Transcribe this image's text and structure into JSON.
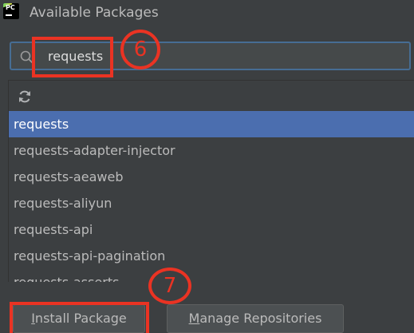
{
  "window": {
    "title": "Available Packages",
    "logo_text": "PC"
  },
  "search": {
    "value": "requests",
    "icon": "search-icon"
  },
  "toolbar": {
    "refresh_icon": "refresh-icon"
  },
  "packages": [
    "requests",
    "requests-adapter-injector",
    "requests-aeaweb",
    "requests-aliyun",
    "requests-api",
    "requests-api-pagination",
    "requests-asserts"
  ],
  "selected_index": 0,
  "buttons": {
    "install_mnemonic": "I",
    "install_rest": "nstall Package",
    "manage_mnemonic": "M",
    "manage_rest": "anage Repositories"
  },
  "annotations": {
    "step6": "6",
    "step7": "7"
  },
  "colors": {
    "background": "#3c3f41",
    "selection": "#4b6eaf",
    "focus_border": "#466d94",
    "annotation": "#ea3323"
  }
}
